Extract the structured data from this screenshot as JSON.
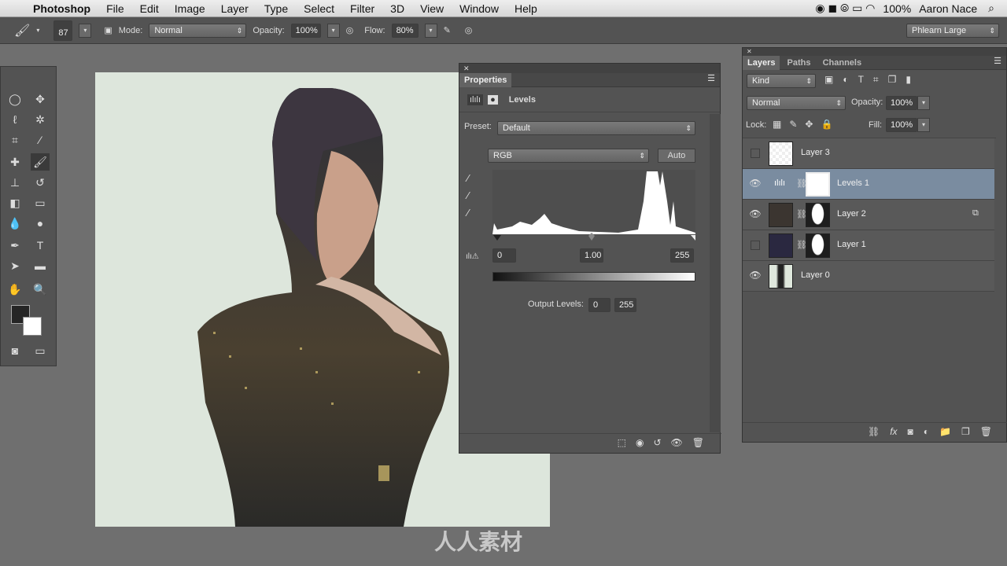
{
  "menubar": {
    "app": "Photoshop",
    "items": [
      "File",
      "Edit",
      "Image",
      "Layer",
      "Type",
      "Select",
      "Filter",
      "3D",
      "View",
      "Window",
      "Help"
    ],
    "battery": "100%",
    "user": "Aaron Nace"
  },
  "options": {
    "brush_size": "87",
    "mode_label": "Mode:",
    "mode": "Normal",
    "opacity_label": "Opacity:",
    "opacity": "100%",
    "flow_label": "Flow:",
    "flow": "80%",
    "workspace": "Phlearn Large"
  },
  "properties": {
    "tab": "Properties",
    "title": "Levels",
    "preset_label": "Preset:",
    "preset": "Default",
    "channel": "RGB",
    "auto": "Auto",
    "input_black": "0",
    "input_gamma": "1.00",
    "input_white": "255",
    "output_label": "Output Levels:",
    "output_black": "0",
    "output_white": "255"
  },
  "layers_panel": {
    "tabs": [
      "Layers",
      "Paths",
      "Channels"
    ],
    "filter": "Kind",
    "blend": "Normal",
    "opacity_label": "Opacity:",
    "opacity": "100%",
    "lock_label": "Lock:",
    "fill_label": "Fill:",
    "fill": "100%",
    "layers": [
      {
        "name": "Layer 3",
        "visible": false
      },
      {
        "name": "Levels 1",
        "visible": true,
        "selected": true
      },
      {
        "name": "Layer 2",
        "visible": true
      },
      {
        "name": "Layer 1",
        "visible": false
      },
      {
        "name": "Layer 0",
        "visible": true
      }
    ]
  },
  "watermark": "人人素材",
  "colors": {
    "panel": "#535353",
    "selected_layer": "#7a8ca0",
    "canvas_bg": "#dde6dc"
  }
}
